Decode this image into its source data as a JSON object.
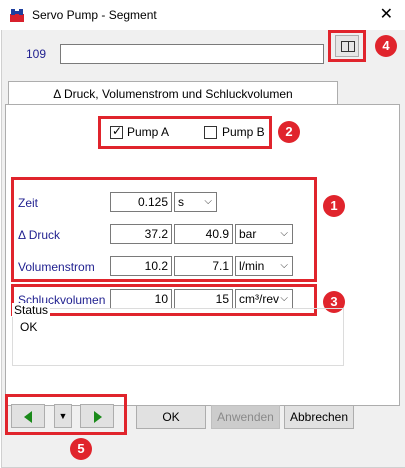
{
  "window": {
    "title": "Servo Pump - Segment",
    "close_glyph": "✕"
  },
  "segment": {
    "label": "109",
    "value": ""
  },
  "tab": {
    "label": "Δ Druck, Volumenstrom und Schluckvolumen"
  },
  "pumps": [
    {
      "label": "Pump A",
      "checked": true
    },
    {
      "label": "Pump B",
      "checked": false
    }
  ],
  "fields": {
    "zeit": {
      "label": "Zeit",
      "value": "0.125",
      "unit": "s"
    },
    "druck": {
      "label": "Δ Druck",
      "value1": "37.2",
      "value2": "40.9",
      "unit": "bar"
    },
    "volumenstrom": {
      "label": "Volumenstrom",
      "value1": "10.2",
      "value2": "7.1",
      "unit": "l/min"
    },
    "schluckvolumen": {
      "label": "Schluckvolumen",
      "value1": "10",
      "value2": "15",
      "unit": "cm³/rev"
    }
  },
  "status": {
    "title": "Status",
    "value": "OK"
  },
  "buttons": {
    "ok": "OK",
    "apply": "Anwenden",
    "cancel": "Abbrechen"
  },
  "badges": [
    "1",
    "2",
    "3",
    "4",
    "5"
  ],
  "colors": {
    "highlight": "#e0242c",
    "label_blue": "#1f1f8f",
    "nav_green": "#1a8a1a"
  }
}
